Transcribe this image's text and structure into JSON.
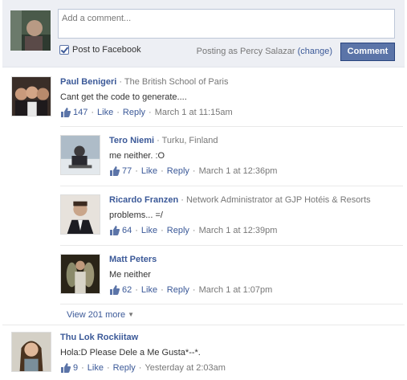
{
  "composer": {
    "placeholder": "Add a comment...",
    "post_to_facebook_label": "Post to Facebook",
    "posting_as_prefix": "Posting as Percy Salazar",
    "change_label": "(change)",
    "comment_button": "Comment"
  },
  "comments": [
    {
      "author": "Paul Benigeri",
      "subtitle": "· The British School of Paris",
      "text": "Cant get the code to generate....",
      "likes": "147",
      "like_label": "Like",
      "reply_label": "Reply",
      "time": "March 1 at 11:15am"
    },
    {
      "author": "Tero Niemi",
      "subtitle": "· Turku, Finland",
      "text": "me neither. :O",
      "likes": "77",
      "like_label": "Like",
      "reply_label": "Reply",
      "time": "March 1 at 12:36pm"
    },
    {
      "author": "Ricardo Franzen",
      "subtitle": "· Network Administrator at GJP Hotéis & Resorts",
      "text": "problems... =/",
      "likes": "64",
      "like_label": "Like",
      "reply_label": "Reply",
      "time": "March 1 at 12:39pm"
    },
    {
      "author": "Matt Peters",
      "subtitle": "",
      "text": "Me neither",
      "likes": "62",
      "like_label": "Like",
      "reply_label": "Reply",
      "time": "March 1 at 1:07pm"
    },
    {
      "author": "Thu Lok Rockiitaw",
      "subtitle": "",
      "text": "Hola:D Please Dele a Me Gusta*--*.",
      "likes": "9",
      "like_label": "Like",
      "reply_label": "Reply",
      "time": "Yesterday at 2:03am"
    }
  ],
  "view_more": "View 201 more",
  "colors": {
    "link": "#3b5998",
    "button": "#5b74a8",
    "composer_bg": "#edeff4"
  }
}
